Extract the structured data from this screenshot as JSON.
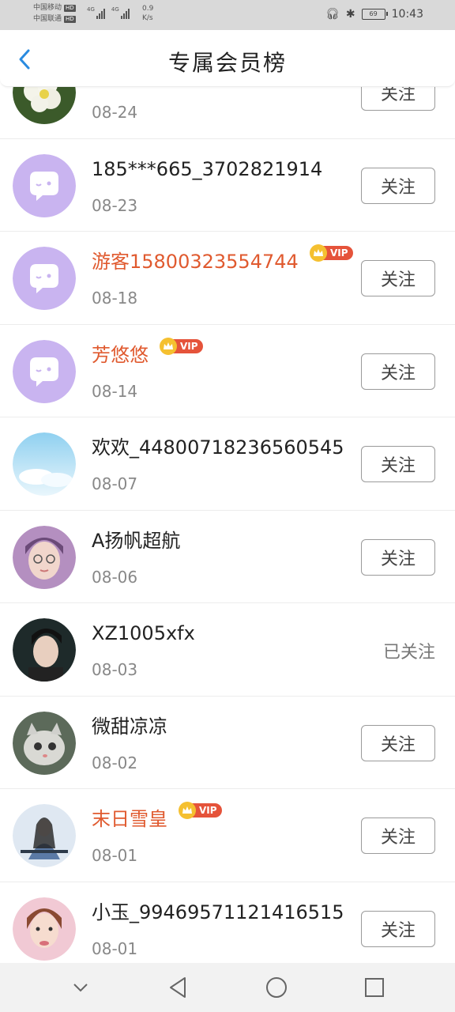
{
  "status_bar": {
    "carrier1": "中国移动",
    "carrier2": "中国联通",
    "hd": "HD",
    "net1": "4G",
    "net2": "4G",
    "speed_value": "0.9",
    "speed_unit": "K/s",
    "battery": "69",
    "time": "10:43"
  },
  "header": {
    "title": "专属会员榜"
  },
  "vip_label": "VIP",
  "follow_label": "关注",
  "followed_label": "已关注",
  "members": [
    {
      "name": "",
      "date": "08-24",
      "vip": false,
      "followed": false,
      "avatar": "flower"
    },
    {
      "name": "185***665_3702821914",
      "date": "08-23",
      "vip": false,
      "followed": false,
      "avatar": "default"
    },
    {
      "name": "游客15800323554744",
      "date": "08-18",
      "vip": true,
      "followed": false,
      "avatar": "default"
    },
    {
      "name": "芳悠悠",
      "date": "08-14",
      "vip": true,
      "followed": false,
      "avatar": "default"
    },
    {
      "name": "欢欢_44800718236560545",
      "date": "08-07",
      "vip": false,
      "followed": false,
      "avatar": "sky"
    },
    {
      "name": "A扬帆超航",
      "date": "08-06",
      "vip": false,
      "followed": false,
      "avatar": "photo-girl"
    },
    {
      "name": "XZ1005xfx",
      "date": "08-03",
      "vip": false,
      "followed": true,
      "avatar": "photo-man"
    },
    {
      "name": "微甜凉凉",
      "date": "08-02",
      "vip": false,
      "followed": false,
      "avatar": "cat"
    },
    {
      "name": "末日雪皇",
      "date": "08-01",
      "vip": true,
      "followed": false,
      "avatar": "art"
    },
    {
      "name": "小玉_99469571121416515",
      "date": "08-01",
      "vip": false,
      "followed": false,
      "avatar": "photo-woman"
    }
  ],
  "colors": {
    "vip_name": "#e05a2f",
    "default_avatar": "#c9b4f0",
    "accent": "#2a8be0"
  }
}
